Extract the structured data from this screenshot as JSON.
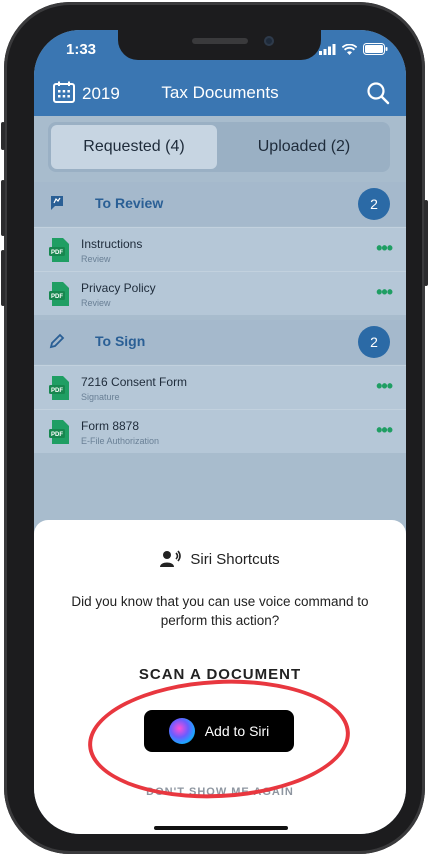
{
  "status_bar": {
    "time": "1:33"
  },
  "header": {
    "year": "2019",
    "title": "Tax Documents"
  },
  "segments": [
    {
      "label": "Requested (4)",
      "active": true
    },
    {
      "label": "Uploaded (2)",
      "active": false
    }
  ],
  "sections": [
    {
      "title": "To Review",
      "count": "2",
      "icon": "review-flag-icon",
      "items": [
        {
          "name": "Instructions",
          "subtitle": "Review"
        },
        {
          "name": "Privacy Policy",
          "subtitle": "Review"
        }
      ]
    },
    {
      "title": "To Sign",
      "count": "2",
      "icon": "pencil-icon",
      "items": [
        {
          "name": "7216 Consent Form",
          "subtitle": "Signature"
        },
        {
          "name": "Form 8878",
          "subtitle": "E-File Authorization"
        }
      ]
    }
  ],
  "row_action_glyph": "•••",
  "siri_sheet": {
    "title": "Siri Shortcuts",
    "description": "Did you know that you can use voice command to perform this action?",
    "action": "SCAN A DOCUMENT",
    "add_button": "Add to Siri",
    "dismiss": "DON'T SHOW ME AGAIN"
  },
  "colors": {
    "header": "#3a76b2",
    "accent": "#2b6aa6",
    "pdf": "#1f9e63",
    "highlight": "#e8373f"
  }
}
